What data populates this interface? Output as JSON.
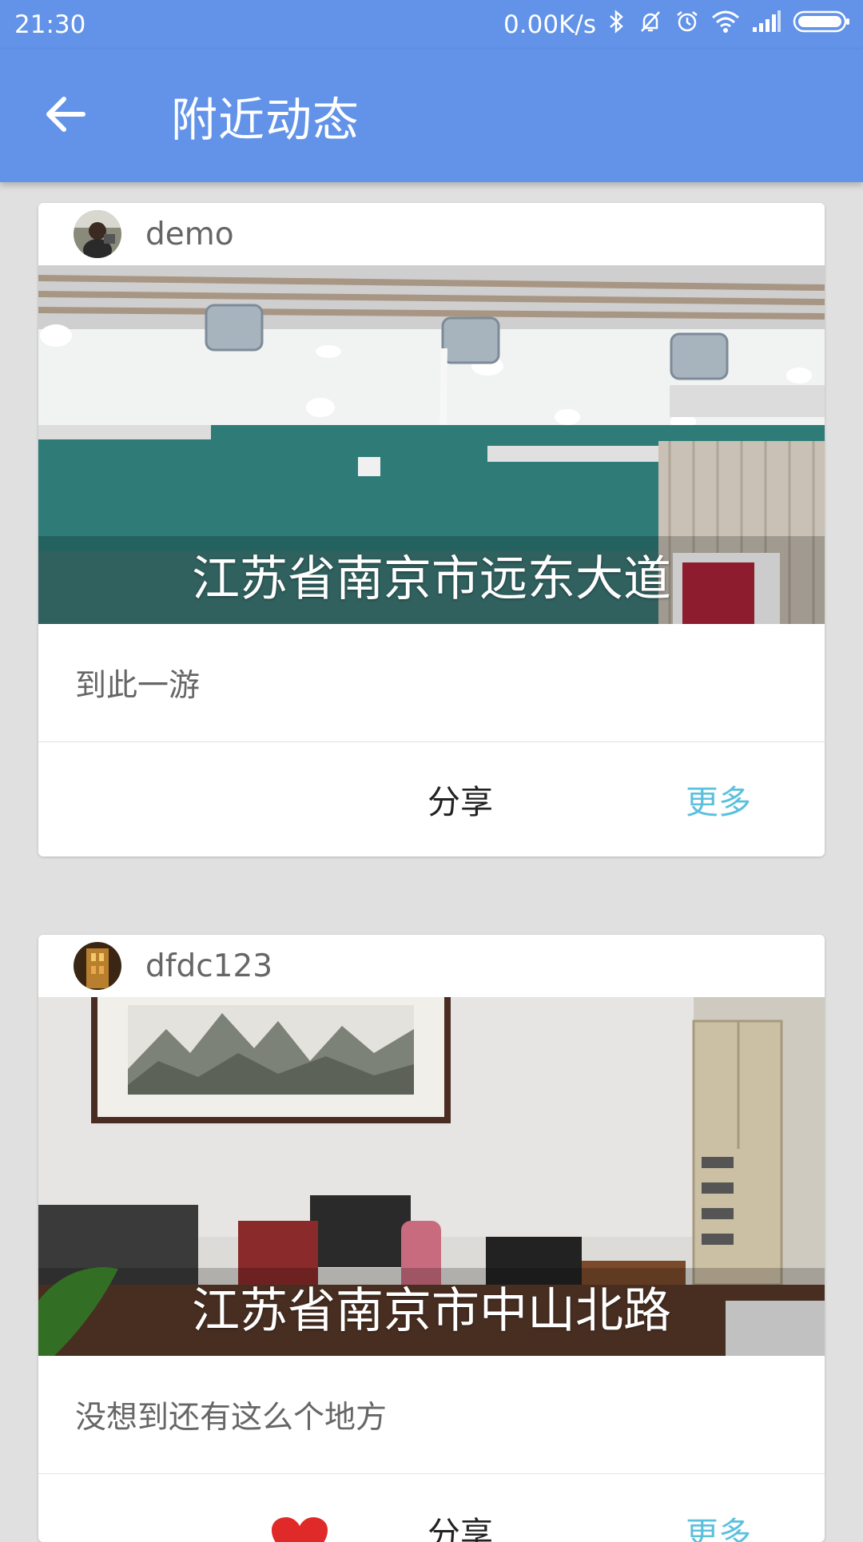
{
  "status_bar": {
    "time": "21:30",
    "net_speed": "0.00K/s",
    "icons": [
      "bluetooth-icon",
      "bell-off-icon",
      "alarm-icon",
      "wifi-icon",
      "signal-icon",
      "battery-icon"
    ]
  },
  "app_bar": {
    "back_icon": "arrow-left-icon",
    "title": "附近动态"
  },
  "posts": [
    {
      "username": "demo",
      "location": "江苏省南京市远东大道",
      "description": "到此一游",
      "share_label": "分享",
      "more_label": "更多"
    },
    {
      "username": "dfdc123",
      "location": "江苏省南京市中山北路",
      "description": "没想到还有这么个地方",
      "share_label": "分享",
      "more_label": "更多",
      "liked": true
    }
  ],
  "colors": {
    "primary": "#6293e8",
    "accent_more": "#5bc0de",
    "like": "#e02a2a",
    "background": "#e0e0e0"
  }
}
